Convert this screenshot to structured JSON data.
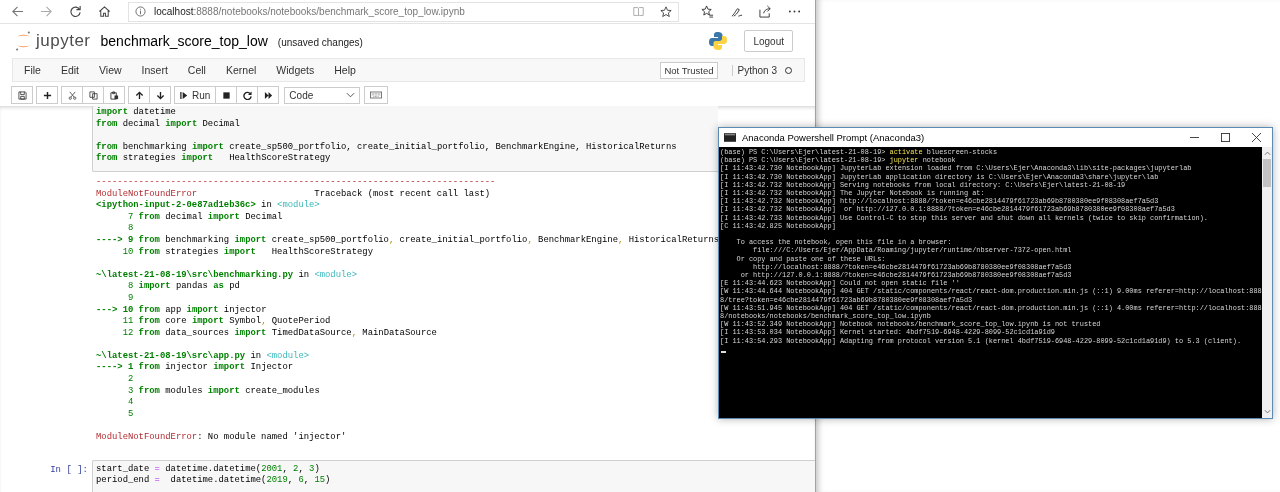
{
  "browser": {
    "url_host": "localhost",
    "url_rest": ":8888/notebooks/notebooks/benchmark_score_top_low.ipynb"
  },
  "header": {
    "logo_text": "jupyter",
    "notebook_name": "benchmark_score_top_low",
    "save_status": "(unsaved changes)",
    "logout": "Logout"
  },
  "menu": [
    "File",
    "Edit",
    "View",
    "Insert",
    "Cell",
    "Kernel",
    "Widgets",
    "Help"
  ],
  "trust_badge": "Not Trusted",
  "kernel": {
    "name": "Python 3",
    "busy": false
  },
  "toolbar": {
    "run_label": "Run",
    "cell_type": "Code"
  },
  "source_cell": {
    "blocks": [
      [
        [
          {
            "text": "import",
            "kind": "kw"
          },
          {
            "text": " datetime",
            "kind": "plain"
          }
        ],
        [
          {
            "text": "from",
            "kind": "kw"
          },
          {
            "text": " decimal ",
            "kind": "plain"
          },
          {
            "text": "import",
            "kind": "kw"
          },
          {
            "text": " Decimal",
            "kind": "plain"
          }
        ]
      ],
      [
        [
          {
            "text": "from",
            "kind": "kw"
          },
          {
            "text": " benchmarking ",
            "kind": "plain"
          },
          {
            "text": "import",
            "kind": "kw"
          },
          {
            "text": " create_sp500_portfolio, create_initial_portfolio, BenchmarkEngine, HistoricalReturns",
            "kind": "plain"
          }
        ],
        [
          {
            "text": "from",
            "kind": "kw"
          },
          {
            "text": " strategies ",
            "kind": "plain"
          },
          {
            "text": "import",
            "kind": "kw"
          },
          {
            "text": "   HealthScoreStrategy",
            "kind": "plain"
          }
        ]
      ]
    ]
  },
  "output": {
    "blocks": [
      [
        [
          {
            "text": "---------------------------------------------------------------------------",
            "kind": "err"
          }
        ],
        [
          {
            "text": "ModuleNotFoundError",
            "kind": "err"
          },
          {
            "text": "                      Traceback (most recent call last)",
            "kind": "plain"
          }
        ],
        [
          {
            "text": "<ipython-input-2-0e87ad1eb36c>",
            "kind": "path"
          },
          {
            "text": " in ",
            "kind": "plain"
          },
          {
            "text": "<module>",
            "kind": "mod"
          }
        ],
        [
          {
            "text": "      7 ",
            "kind": "num"
          },
          {
            "text": "from",
            "kind": "kw"
          },
          {
            "text": " decimal ",
            "kind": "plain"
          },
          {
            "text": "import",
            "kind": "kw"
          },
          {
            "text": " Decimal",
            "kind": "plain"
          }
        ],
        [
          {
            "text": "      8",
            "kind": "num"
          }
        ],
        [
          {
            "text": "----> 9 ",
            "kind": "arrow"
          },
          {
            "text": "from",
            "kind": "kw"
          },
          {
            "text": " benchmarking ",
            "kind": "plain"
          },
          {
            "text": "import",
            "kind": "kw"
          },
          {
            "text": " create_sp500_portfolio",
            "kind": "plain"
          },
          {
            "text": ",",
            "kind": "punct"
          },
          {
            "text": " create_initial_portfolio",
            "kind": "plain"
          },
          {
            "text": ",",
            "kind": "punct"
          },
          {
            "text": " BenchmarkEngine",
            "kind": "plain"
          },
          {
            "text": ",",
            "kind": "punct"
          },
          {
            "text": " HistoricalReturns",
            "kind": "plain"
          }
        ],
        [
          {
            "text": "     10 ",
            "kind": "num"
          },
          {
            "text": "from",
            "kind": "kw"
          },
          {
            "text": " strategies ",
            "kind": "plain"
          },
          {
            "text": "import",
            "kind": "kw"
          },
          {
            "text": "   HealthScoreStrategy",
            "kind": "plain"
          }
        ]
      ],
      [
        [
          {
            "text": "~\\latest-21-08-19\\src\\benchmarking.py",
            "kind": "path"
          },
          {
            "text": " in ",
            "kind": "plain"
          },
          {
            "text": "<module>",
            "kind": "mod"
          }
        ],
        [
          {
            "text": "      8 ",
            "kind": "num"
          },
          {
            "text": "import",
            "kind": "kw"
          },
          {
            "text": " pandas ",
            "kind": "plain"
          },
          {
            "text": "as",
            "kind": "kw"
          },
          {
            "text": " pd",
            "kind": "plain"
          }
        ],
        [
          {
            "text": "      9",
            "kind": "num"
          }
        ],
        [
          {
            "text": "---> 10 ",
            "kind": "arrow"
          },
          {
            "text": "from",
            "kind": "kw"
          },
          {
            "text": " app ",
            "kind": "plain"
          },
          {
            "text": "import",
            "kind": "kw"
          },
          {
            "text": " injector",
            "kind": "plain"
          }
        ],
        [
          {
            "text": "     11 ",
            "kind": "num"
          },
          {
            "text": "from",
            "kind": "kw"
          },
          {
            "text": " core ",
            "kind": "plain"
          },
          {
            "text": "import",
            "kind": "kw"
          },
          {
            "text": " Symbol",
            "kind": "plain"
          },
          {
            "text": ",",
            "kind": "punct"
          },
          {
            "text": " QuotePeriod",
            "kind": "plain"
          }
        ],
        [
          {
            "text": "     12 ",
            "kind": "num"
          },
          {
            "text": "from",
            "kind": "kw"
          },
          {
            "text": " data_sources ",
            "kind": "plain"
          },
          {
            "text": "import",
            "kind": "kw"
          },
          {
            "text": " TimedDataSource",
            "kind": "plain"
          },
          {
            "text": ",",
            "kind": "punct"
          },
          {
            "text": " MainDataSource",
            "kind": "plain"
          }
        ]
      ],
      [
        [
          {
            "text": "~\\latest-21-08-19\\src\\app.py",
            "kind": "path"
          },
          {
            "text": " in ",
            "kind": "plain"
          },
          {
            "text": "<module>",
            "kind": "mod"
          }
        ],
        [
          {
            "text": "----> 1 ",
            "kind": "arrow"
          },
          {
            "text": "from",
            "kind": "kw"
          },
          {
            "text": " injector ",
            "kind": "plain"
          },
          {
            "text": "import",
            "kind": "kw"
          },
          {
            "text": " Injector",
            "kind": "plain"
          }
        ],
        [
          {
            "text": "      2",
            "kind": "num"
          }
        ],
        [
          {
            "text": "      3 ",
            "kind": "num"
          },
          {
            "text": "from",
            "kind": "kw"
          },
          {
            "text": " modules ",
            "kind": "plain"
          },
          {
            "text": "import",
            "kind": "kw"
          },
          {
            "text": " create_modules",
            "kind": "plain"
          }
        ],
        [
          {
            "text": "      4",
            "kind": "num"
          }
        ],
        [
          {
            "text": "      5",
            "kind": "num"
          }
        ]
      ],
      [
        [
          {
            "text": "ModuleNotFoundError",
            "kind": "err"
          },
          {
            "text": ": No module named 'injector'",
            "kind": "plain"
          }
        ]
      ]
    ]
  },
  "next_cell": {
    "prompt": "In [ ]:",
    "lines": [
      [
        {
          "text": "start_date ",
          "kind": "plain"
        },
        {
          "text": "=",
          "kind": "op"
        },
        {
          "text": " datetime.datetime(",
          "kind": "plain"
        },
        {
          "text": "2001",
          "kind": "num"
        },
        {
          "text": ", ",
          "kind": "plain"
        },
        {
          "text": "2",
          "kind": "num"
        },
        {
          "text": ", ",
          "kind": "plain"
        },
        {
          "text": "3",
          "kind": "num"
        },
        {
          "text": ")",
          "kind": "plain"
        }
      ],
      [
        {
          "text": "period_end ",
          "kind": "plain"
        },
        {
          "text": "=",
          "kind": "op"
        },
        {
          "text": "  datetime.datetime(",
          "kind": "plain"
        },
        {
          "text": "2019",
          "kind": "num"
        },
        {
          "text": ", ",
          "kind": "plain"
        },
        {
          "text": "6",
          "kind": "num"
        },
        {
          "text": ", ",
          "kind": "plain"
        },
        {
          "text": "15",
          "kind": "num"
        },
        {
          "text": ")",
          "kind": "plain"
        }
      ]
    ]
  },
  "terminal": {
    "title": "Anaconda Powershell Prompt (Anaconda3)",
    "blocks": [
      [
        [
          {
            "text": "(base) PS C:\\Users\\Ejer\\latest-21-08-19> ",
            "kind": "plain"
          },
          {
            "text": "activate",
            "kind": "cmd"
          },
          {
            "text": " bluescreen-stocks",
            "kind": "plain"
          }
        ],
        [
          {
            "text": "(base) PS C:\\Users\\Ejer\\latest-21-08-19> ",
            "kind": "plain"
          },
          {
            "text": "jupyter",
            "kind": "cmd"
          },
          {
            "text": " notebook",
            "kind": "plain"
          }
        ],
        [
          {
            "text": "[I 11:43:42.730 NotebookApp] JupyterLab extension loaded from C:\\Users\\Ejer\\Anaconda3\\lib\\site-packages\\jupyterlab",
            "kind": "plain"
          }
        ],
        [
          {
            "text": "[I 11:43:42.730 NotebookApp] JupyterLab application directory is C:\\Users\\Ejer\\Anaconda3\\share\\jupyter\\lab",
            "kind": "plain"
          }
        ],
        [
          {
            "text": "[I 11:43:42.732 NotebookApp] Serving notebooks from local directory: C:\\Users\\Ejer\\latest-21-08-19",
            "kind": "plain"
          }
        ],
        [
          {
            "text": "[I 11:43:42.732 NotebookApp] The Jupyter Notebook is running at:",
            "kind": "plain"
          }
        ],
        [
          {
            "text": "[I 11:43:42.732 NotebookApp] http://localhost:8888/?token=e46cbe2814479f61723ab69b8780380ee9f08308aef7a5d3",
            "kind": "plain"
          }
        ],
        [
          {
            "text": "[I 11:43:42.732 NotebookApp]  or http://127.0.0.1:8888/?token=e46cbe2814479f61723ab69b8780380ee9f08308aef7a5d3",
            "kind": "plain"
          }
        ],
        [
          {
            "text": "[I 11:43:42.733 NotebookApp] Use Control-C to stop this server and shut down all kernels (twice to skip confirmation).",
            "kind": "plain"
          }
        ],
        [
          {
            "text": "[C 11:43:42.825 NotebookApp]",
            "kind": "plain"
          }
        ]
      ],
      [
        [
          {
            "text": "    To access the notebook, open this file in a browser:",
            "kind": "plain"
          }
        ],
        [
          {
            "text": "        file:///C:/Users/Ejer/AppData/Roaming/jupyter/runtime/nbserver-7372-open.html",
            "kind": "plain"
          }
        ],
        [
          {
            "text": "    Or copy and paste one of these URLs:",
            "kind": "plain"
          }
        ],
        [
          {
            "text": "        http://localhost:8888/?token=e46cbe2814479f61723ab69b8780380ee9f08308aef7a5d3",
            "kind": "plain"
          }
        ],
        [
          {
            "text": "     or http://127.0.0.1:8888/?token=e46cbe2814479f61723ab69b8780380ee9f08308aef7a5d3",
            "kind": "plain"
          }
        ],
        [
          {
            "text": "[E 11:43:44.623 NotebookApp] Could not open static file ''",
            "kind": "plain"
          }
        ],
        [
          {
            "text": "[W 11:43:44.644 NotebookApp] 404 GET /static/components/react/react-dom.production.min.js (::1) 9.00ms referer=http://localhost:888",
            "kind": "plain"
          }
        ],
        [
          {
            "text": "8/tree?token=e46cbe2814479f61723ab69b8780380ee9f08308aef7a5d3",
            "kind": "plain"
          }
        ],
        [
          {
            "text": "[W 11:43:51.945 NotebookApp] 404 GET /static/components/react/react-dom.production.min.js (::1) 4.00ms referer=http://localhost:888",
            "kind": "plain"
          }
        ],
        [
          {
            "text": "8/notebooks/notebooks/benchmark_score_top_low.ipynb",
            "kind": "plain"
          }
        ],
        [
          {
            "text": "[W 11:43:52.349 NotebookApp] Notebook notebooks/benchmark_score_top_low.ipynb is not trusted",
            "kind": "plain"
          }
        ],
        [
          {
            "text": "[I 11:43:53.034 NotebookApp] Kernel started: 4bdf7519-6948-4229-8099-52c1cd1a91d9",
            "kind": "plain"
          }
        ],
        [
          {
            "text": "[I 11:43:54.293 NotebookApp] Adapting from protocol version 5.1 (kernel 4bdf7519-6948-4229-8099-52c1cd1a91d9) to 5.3 (client).",
            "kind": "plain"
          }
        ]
      ]
    ]
  }
}
